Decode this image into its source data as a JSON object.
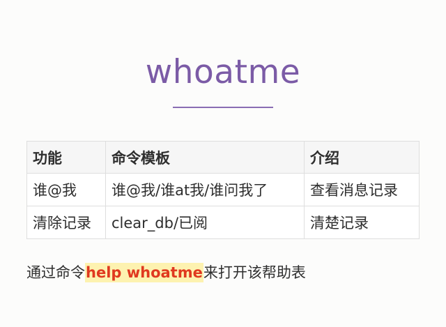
{
  "title": "whoatme",
  "table": {
    "headers": [
      "功能",
      "命令模板",
      "介绍"
    ],
    "rows": [
      [
        "谁@我",
        "谁@我/谁at我/谁问我了",
        "查看消息记录"
      ],
      [
        "清除记录",
        "clear_db/已阅",
        "清楚记录"
      ]
    ]
  },
  "footer": {
    "prefix": "通过命令",
    "command": "help whoatme",
    "suffix": "来打开该帮助表"
  },
  "colors": {
    "title": "#7b5ba6",
    "command_text": "#e0391f",
    "command_highlight": "#fdf2b0"
  }
}
